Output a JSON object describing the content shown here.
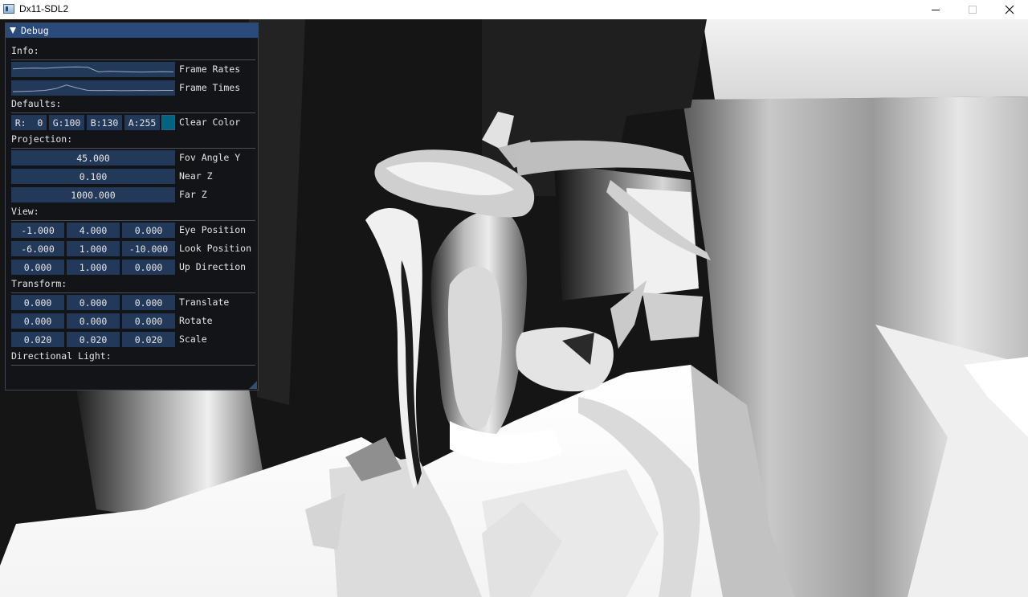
{
  "window": {
    "title": "Dx11-SDL2",
    "minimize_icon": "minimize-icon",
    "maximize_icon": "maximize-icon",
    "close_icon": "close-icon"
  },
  "debug": {
    "title": "Debug",
    "info": {
      "heading": "Info:",
      "frame_rates_label": "Frame Rates",
      "frame_rates_plot": [
        0.55,
        0.6,
        0.62,
        0.6,
        0.65,
        0.7,
        0.72,
        0.68,
        0.3,
        0.35,
        0.33,
        0.3,
        0.28,
        0.3,
        0.32,
        0.3
      ],
      "frame_times_label": "Frame Times",
      "frame_times_plot": [
        0.2,
        0.22,
        0.25,
        0.3,
        0.45,
        0.75,
        0.5,
        0.3,
        0.28,
        0.3,
        0.27,
        0.29,
        0.3,
        0.28,
        0.3,
        0.3
      ]
    },
    "defaults": {
      "heading": "Defaults:",
      "r": "R:  0",
      "g": "G:100",
      "b": "B:130",
      "a": "A:255",
      "swatch_color": "#006482",
      "clear_color_label": "Clear Color"
    },
    "projection": {
      "heading": "Projection:",
      "fov": "45.000",
      "fov_label": "Fov Angle Y",
      "near": "0.100",
      "near_label": "Near Z",
      "far": "1000.000",
      "far_label": "Far Z"
    },
    "view": {
      "heading": "View:",
      "eye": [
        "-1.000",
        "4.000",
        "0.000"
      ],
      "eye_label": "Eye Position",
      "look": [
        "-6.000",
        "1.000",
        "-10.000"
      ],
      "look_label": "Look Position",
      "up": [
        "0.000",
        "1.000",
        "0.000"
      ],
      "up_label": "Up Direction"
    },
    "transform": {
      "heading": "Transform:",
      "translate": [
        "0.000",
        "0.000",
        "0.000"
      ],
      "translate_label": "Translate",
      "rotate": [
        "0.000",
        "0.000",
        "0.000"
      ],
      "rotate_label": "Rotate",
      "scale": [
        "0.020",
        "0.020",
        "0.020"
      ],
      "scale_label": "Scale"
    },
    "light": {
      "heading": "Directional Light:"
    }
  },
  "colors": {
    "panel_header": "#294a7a",
    "field_bg": "#23395a",
    "plot_line": "#9aa7b8"
  }
}
